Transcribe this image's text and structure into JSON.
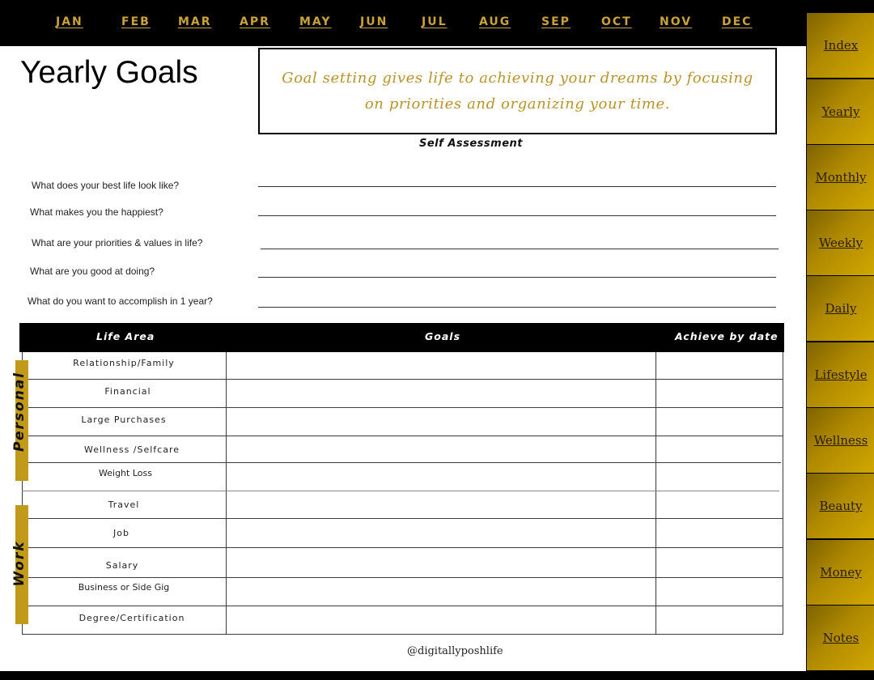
{
  "months": [
    "JAN",
    "FEB",
    "MAR",
    "APR",
    "MAY",
    "JUN",
    "JUL",
    "AUG",
    "SEP",
    "OCT",
    "NOV",
    "DEC"
  ],
  "sidebar": {
    "tabs": [
      "Index",
      "Yearly",
      "Monthly",
      "Weekly",
      "Daily",
      "Lifestyle",
      "Wellness",
      "Beauty",
      "Money",
      "Notes"
    ]
  },
  "page": {
    "title": "Yearly Goals",
    "quote": "Goal setting gives life to achieving your dreams by focusing on priorities and organizing your time.",
    "self_assessment_heading": "Self Assessment"
  },
  "questions": [
    {
      "label": "What does your best life look like?",
      "value": ""
    },
    {
      "label": "What makes you the  happiest?",
      "value": ""
    },
    {
      "label": "What are your priorities & values in life?",
      "value": ""
    },
    {
      "label": "What are you  good at doing?",
      "value": ""
    },
    {
      "label": "What do you want to accomplish in 1 year?",
      "value": ""
    }
  ],
  "table": {
    "headers": {
      "life_area": "Life Area",
      "goals": "Goals",
      "achieve_by": "Achieve by date"
    },
    "groups": [
      {
        "label": "Personal",
        "color": "#c09a18"
      },
      {
        "label": "Work",
        "color": "#c09a18"
      }
    ],
    "rows": [
      {
        "area": "Relationship/Family",
        "goal": "",
        "date": ""
      },
      {
        "area": "Financial",
        "goal": "",
        "date": ""
      },
      {
        "area": "Large Purchases",
        "goal": "",
        "date": ""
      },
      {
        "area": "Wellness /Selfcare",
        "goal": "",
        "date": ""
      },
      {
        "area": "Weight Loss",
        "goal": "",
        "date": ""
      },
      {
        "area": "Travel",
        "goal": "",
        "date": ""
      },
      {
        "area": "Job",
        "goal": "",
        "date": ""
      },
      {
        "area": "Salary",
        "goal": "",
        "date": ""
      },
      {
        "area": "Business or Side Gig",
        "goal": "",
        "date": ""
      },
      {
        "area": "Degree/Certification",
        "goal": "",
        "date": ""
      }
    ]
  },
  "footer": {
    "handle": "@digitallyposhlife"
  },
  "colors": {
    "gold": "#c9a23a",
    "quote_gold": "#b8932a",
    "tab_gold": "#b08a00",
    "black": "#000000"
  }
}
